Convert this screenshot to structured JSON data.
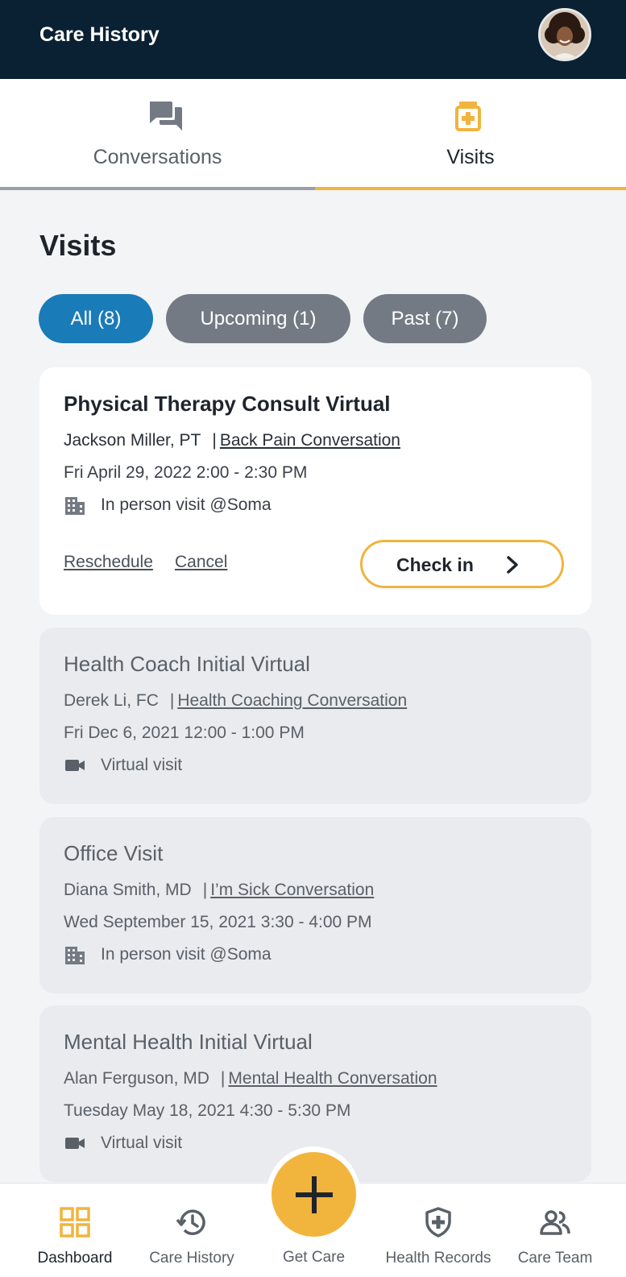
{
  "header": {
    "title": "Care History"
  },
  "tabs": [
    {
      "label": "Conversations",
      "icon": "chat-bubbles-icon",
      "active": false
    },
    {
      "label": "Visits",
      "icon": "medical-kit-icon",
      "active": true
    }
  ],
  "section_title": "Visits",
  "filters": [
    {
      "label": "All (8)",
      "active": true
    },
    {
      "label": "Upcoming (1)",
      "active": false
    },
    {
      "label": "Past (7)",
      "active": false
    }
  ],
  "visits": [
    {
      "title": "Physical Therapy Consult Virtual",
      "provider": "Jackson Miller, PT",
      "separator": "|",
      "conversation": "Back Pain Conversation",
      "datetime": "Fri April 29, 2022   2:00 - 2:30 PM",
      "location_icon": "building-icon",
      "location": "In person visit @Soma",
      "actions": {
        "reschedule": "Reschedule",
        "cancel": "Cancel",
        "checkin": "Check in"
      }
    },
    {
      "title": "Health Coach Initial Virtual",
      "provider": "Derek Li, FC",
      "separator": "|",
      "conversation": "Health Coaching Conversation",
      "datetime": "Fri Dec 6, 2021   12:00 - 1:00 PM",
      "location_icon": "video-camera-icon",
      "location": "Virtual visit"
    },
    {
      "title": "Office Visit",
      "provider": "Diana Smith, MD",
      "separator": "|",
      "conversation": "I’m Sick Conversation",
      "datetime": "Wed September 15, 2021   3:30 - 4:00 PM",
      "location_icon": "building-icon",
      "location": "In person visit @Soma"
    },
    {
      "title": "Mental Health Initial Virtual",
      "provider": "Alan Ferguson, MD",
      "separator": "|",
      "conversation": "Mental Health Conversation",
      "datetime": "Tuesday May 18, 2021   4:30 - 5:30 PM",
      "location_icon": "video-camera-icon",
      "location": "Virtual visit"
    }
  ],
  "bottom_nav": [
    {
      "label": "Dashboard",
      "icon": "dashboard-grid-icon",
      "active": true
    },
    {
      "label": "Care History",
      "icon": "history-clock-icon",
      "active": false
    },
    {
      "label": "Get Care",
      "icon": "plus-icon",
      "active": false
    },
    {
      "label": "Health Records",
      "icon": "shield-cross-icon",
      "active": false
    },
    {
      "label": "Care Team",
      "icon": "people-icon",
      "active": false
    }
  ],
  "colors": {
    "header_bg": "#0a2133",
    "accent": "#f1b43c",
    "primary": "#1a7bb9",
    "chip_inactive": "#737a83",
    "page_bg": "#f3f4f6"
  }
}
